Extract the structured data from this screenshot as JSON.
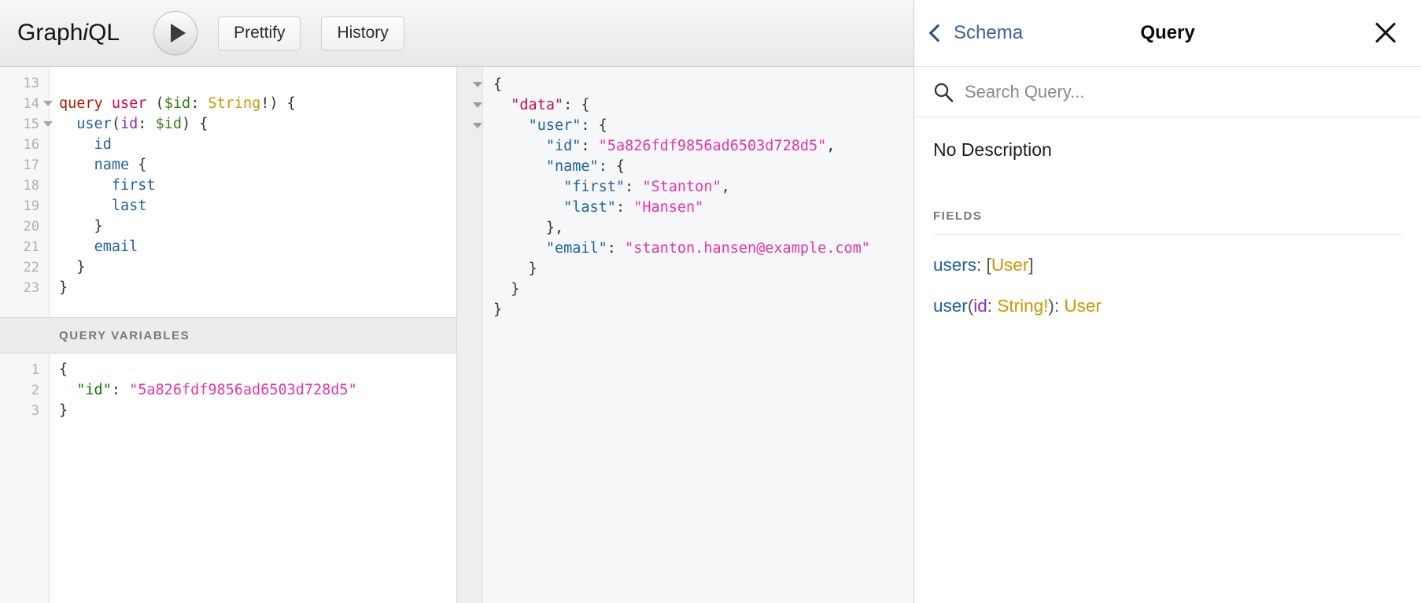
{
  "toolbar": {
    "logo_prefix": "Graph",
    "logo_italic": "i",
    "logo_suffix": "QL",
    "execute_label": "play-triangle",
    "prettify_label": "Prettify",
    "history_label": "History"
  },
  "query_editor": {
    "first_line_number": 13,
    "lines": [
      {
        "n": 13,
        "fold": false,
        "tokens": []
      },
      {
        "n": 14,
        "fold": true,
        "tokens": [
          {
            "t": "query",
            "c": "t-kw"
          },
          {
            "t": " ",
            "c": "t-punct"
          },
          {
            "t": "user",
            "c": "t-def"
          },
          {
            "t": " (",
            "c": "t-punct"
          },
          {
            "t": "$id",
            "c": "t-var"
          },
          {
            "t": ": ",
            "c": "t-punct"
          },
          {
            "t": "String",
            "c": "t-type"
          },
          {
            "t": "!) {",
            "c": "t-punct"
          }
        ]
      },
      {
        "n": 15,
        "fold": true,
        "tokens": [
          {
            "t": "  ",
            "c": "t-punct"
          },
          {
            "t": "user",
            "c": "t-field"
          },
          {
            "t": "(",
            "c": "t-punct"
          },
          {
            "t": "id",
            "c": "t-attr"
          },
          {
            "t": ": ",
            "c": "t-punct"
          },
          {
            "t": "$id",
            "c": "t-var"
          },
          {
            "t": ") {",
            "c": "t-punct"
          }
        ]
      },
      {
        "n": 16,
        "fold": false,
        "tokens": [
          {
            "t": "    ",
            "c": "t-punct"
          },
          {
            "t": "id",
            "c": "t-field"
          }
        ]
      },
      {
        "n": 17,
        "fold": false,
        "tokens": [
          {
            "t": "    ",
            "c": "t-punct"
          },
          {
            "t": "name",
            "c": "t-field"
          },
          {
            "t": " {",
            "c": "t-punct"
          }
        ]
      },
      {
        "n": 18,
        "fold": false,
        "tokens": [
          {
            "t": "      ",
            "c": "t-punct"
          },
          {
            "t": "first",
            "c": "t-field"
          }
        ]
      },
      {
        "n": 19,
        "fold": false,
        "tokens": [
          {
            "t": "      ",
            "c": "t-punct"
          },
          {
            "t": "last",
            "c": "t-field"
          }
        ]
      },
      {
        "n": 20,
        "fold": false,
        "tokens": [
          {
            "t": "    }",
            "c": "t-punct"
          }
        ]
      },
      {
        "n": 21,
        "fold": false,
        "tokens": [
          {
            "t": "    ",
            "c": "t-punct"
          },
          {
            "t": "email",
            "c": "t-field"
          }
        ]
      },
      {
        "n": 22,
        "fold": false,
        "tokens": [
          {
            "t": "  }",
            "c": "t-punct"
          }
        ]
      },
      {
        "n": 23,
        "fold": false,
        "tokens": [
          {
            "t": "}",
            "c": "t-punct"
          }
        ]
      }
    ],
    "plain_text": "query user ($id: String!) {\n  user(id: $id) {\n    id\n    name {\n      first\n      last\n    }\n    email\n  }\n}"
  },
  "variables_panel": {
    "header_label": "QUERY VARIABLES",
    "lines": [
      {
        "n": 1,
        "tokens": [
          {
            "t": "{",
            "c": "t-punct"
          }
        ]
      },
      {
        "n": 2,
        "tokens": [
          {
            "t": "  ",
            "c": "t-punct"
          },
          {
            "t": "\"id\"",
            "c": "t-varkey"
          },
          {
            "t": ": ",
            "c": "t-punct"
          },
          {
            "t": "\"5a826fdf9856ad6503d728d5\"",
            "c": "t-str"
          }
        ]
      },
      {
        "n": 3,
        "tokens": [
          {
            "t": "}",
            "c": "t-punct"
          }
        ]
      }
    ],
    "plain_text": "{\n  \"id\": \"5a826fdf9856ad6503d728d5\"\n}"
  },
  "response_panel": {
    "lines": [
      {
        "fold": true,
        "tokens": [
          {
            "t": "{",
            "c": "t-punct"
          }
        ]
      },
      {
        "fold": true,
        "tokens": [
          {
            "t": "  ",
            "c": "t-punct"
          },
          {
            "t": "\"data\"",
            "c": "t-datakey"
          },
          {
            "t": ": {",
            "c": "t-punct"
          }
        ]
      },
      {
        "fold": true,
        "tokens": [
          {
            "t": "    ",
            "c": "t-punct"
          },
          {
            "t": "\"user\"",
            "c": "t-prop"
          },
          {
            "t": ": {",
            "c": "t-punct"
          }
        ]
      },
      {
        "fold": false,
        "tokens": [
          {
            "t": "      ",
            "c": "t-punct"
          },
          {
            "t": "\"id\"",
            "c": "t-prop"
          },
          {
            "t": ": ",
            "c": "t-punct"
          },
          {
            "t": "\"5a826fdf9856ad6503d728d5\"",
            "c": "t-str"
          },
          {
            "t": ",",
            "c": "t-punct"
          }
        ]
      },
      {
        "fold": false,
        "tokens": [
          {
            "t": "      ",
            "c": "t-punct"
          },
          {
            "t": "\"name\"",
            "c": "t-prop"
          },
          {
            "t": ": {",
            "c": "t-punct"
          }
        ]
      },
      {
        "fold": false,
        "tokens": [
          {
            "t": "        ",
            "c": "t-punct"
          },
          {
            "t": "\"first\"",
            "c": "t-prop"
          },
          {
            "t": ": ",
            "c": "t-punct"
          },
          {
            "t": "\"Stanton\"",
            "c": "t-str"
          },
          {
            "t": ",",
            "c": "t-punct"
          }
        ]
      },
      {
        "fold": false,
        "tokens": [
          {
            "t": "        ",
            "c": "t-punct"
          },
          {
            "t": "\"last\"",
            "c": "t-prop"
          },
          {
            "t": ": ",
            "c": "t-punct"
          },
          {
            "t": "\"Hansen\"",
            "c": "t-str"
          }
        ]
      },
      {
        "fold": false,
        "tokens": [
          {
            "t": "      },",
            "c": "t-punct"
          }
        ]
      },
      {
        "fold": false,
        "tokens": [
          {
            "t": "      ",
            "c": "t-punct"
          },
          {
            "t": "\"email\"",
            "c": "t-prop"
          },
          {
            "t": ": ",
            "c": "t-punct"
          },
          {
            "t": "\"stanton.hansen@example.com\"",
            "c": "t-str"
          }
        ]
      },
      {
        "fold": false,
        "tokens": [
          {
            "t": "    }",
            "c": "t-punct"
          }
        ]
      },
      {
        "fold": false,
        "tokens": [
          {
            "t": "  }",
            "c": "t-punct"
          }
        ]
      },
      {
        "fold": false,
        "tokens": [
          {
            "t": "}",
            "c": "t-punct"
          }
        ]
      }
    ],
    "plain_text": "{\n  \"data\": {\n    \"user\": {\n      \"id\": \"5a826fdf9856ad6503d728d5\",\n      \"name\": {\n        \"first\": \"Stanton\",\n        \"last\": \"Hansen\"\n      },\n      \"email\": \"stanton.hansen@example.com\"\n    }\n  }\n}"
  },
  "doc_panel": {
    "back_label": "Schema",
    "title": "Query",
    "close_label": "close",
    "search_placeholder": "Search Query...",
    "search_value": "",
    "description": "No Description",
    "fields_title": "FIELDS",
    "fields": [
      {
        "name": "users",
        "sep": ": ",
        "open": "[",
        "type": "User",
        "close": "]"
      },
      {
        "name": "user",
        "sep": ": ",
        "arg_open": "(",
        "arg_name": "id",
        "arg_sep": ": ",
        "arg_type": "String!",
        "arg_close": ")",
        "type": "User"
      }
    ]
  },
  "colors": {
    "keyword": "#b11a04",
    "operation_name": "#d2054e",
    "variable": "#397d13",
    "type": "#ca9800",
    "argument": "#8b2bb9",
    "field": "#1f61a0",
    "string": "#e535ab",
    "link": "#3b5fa0"
  }
}
